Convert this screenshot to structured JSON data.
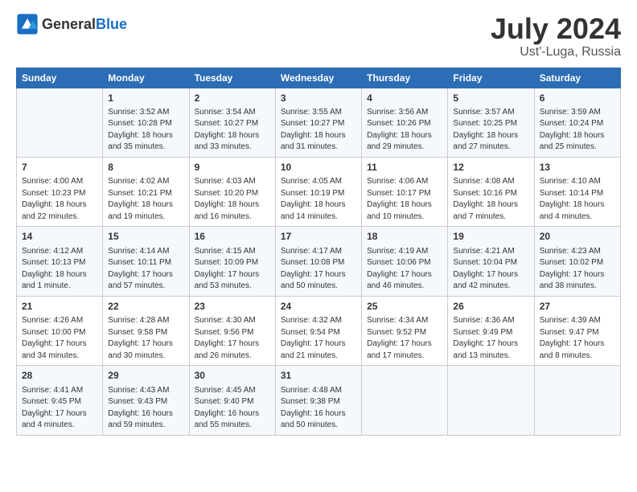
{
  "header": {
    "logo_general": "General",
    "logo_blue": "Blue",
    "title": "July 2024",
    "subtitle": "Ust'-Luga, Russia"
  },
  "columns": [
    "Sunday",
    "Monday",
    "Tuesday",
    "Wednesday",
    "Thursday",
    "Friday",
    "Saturday"
  ],
  "weeks": [
    [
      {
        "day": "",
        "info": ""
      },
      {
        "day": "1",
        "info": "Sunrise: 3:52 AM\nSunset: 10:28 PM\nDaylight: 18 hours\nand 35 minutes."
      },
      {
        "day": "2",
        "info": "Sunrise: 3:54 AM\nSunset: 10:27 PM\nDaylight: 18 hours\nand 33 minutes."
      },
      {
        "day": "3",
        "info": "Sunrise: 3:55 AM\nSunset: 10:27 PM\nDaylight: 18 hours\nand 31 minutes."
      },
      {
        "day": "4",
        "info": "Sunrise: 3:56 AM\nSunset: 10:26 PM\nDaylight: 18 hours\nand 29 minutes."
      },
      {
        "day": "5",
        "info": "Sunrise: 3:57 AM\nSunset: 10:25 PM\nDaylight: 18 hours\nand 27 minutes."
      },
      {
        "day": "6",
        "info": "Sunrise: 3:59 AM\nSunset: 10:24 PM\nDaylight: 18 hours\nand 25 minutes."
      }
    ],
    [
      {
        "day": "7",
        "info": "Sunrise: 4:00 AM\nSunset: 10:23 PM\nDaylight: 18 hours\nand 22 minutes."
      },
      {
        "day": "8",
        "info": "Sunrise: 4:02 AM\nSunset: 10:21 PM\nDaylight: 18 hours\nand 19 minutes."
      },
      {
        "day": "9",
        "info": "Sunrise: 4:03 AM\nSunset: 10:20 PM\nDaylight: 18 hours\nand 16 minutes."
      },
      {
        "day": "10",
        "info": "Sunrise: 4:05 AM\nSunset: 10:19 PM\nDaylight: 18 hours\nand 14 minutes."
      },
      {
        "day": "11",
        "info": "Sunrise: 4:06 AM\nSunset: 10:17 PM\nDaylight: 18 hours\nand 10 minutes."
      },
      {
        "day": "12",
        "info": "Sunrise: 4:08 AM\nSunset: 10:16 PM\nDaylight: 18 hours\nand 7 minutes."
      },
      {
        "day": "13",
        "info": "Sunrise: 4:10 AM\nSunset: 10:14 PM\nDaylight: 18 hours\nand 4 minutes."
      }
    ],
    [
      {
        "day": "14",
        "info": "Sunrise: 4:12 AM\nSunset: 10:13 PM\nDaylight: 18 hours\nand 1 minute."
      },
      {
        "day": "15",
        "info": "Sunrise: 4:14 AM\nSunset: 10:11 PM\nDaylight: 17 hours\nand 57 minutes."
      },
      {
        "day": "16",
        "info": "Sunrise: 4:15 AM\nSunset: 10:09 PM\nDaylight: 17 hours\nand 53 minutes."
      },
      {
        "day": "17",
        "info": "Sunrise: 4:17 AM\nSunset: 10:08 PM\nDaylight: 17 hours\nand 50 minutes."
      },
      {
        "day": "18",
        "info": "Sunrise: 4:19 AM\nSunset: 10:06 PM\nDaylight: 17 hours\nand 46 minutes."
      },
      {
        "day": "19",
        "info": "Sunrise: 4:21 AM\nSunset: 10:04 PM\nDaylight: 17 hours\nand 42 minutes."
      },
      {
        "day": "20",
        "info": "Sunrise: 4:23 AM\nSunset: 10:02 PM\nDaylight: 17 hours\nand 38 minutes."
      }
    ],
    [
      {
        "day": "21",
        "info": "Sunrise: 4:26 AM\nSunset: 10:00 PM\nDaylight: 17 hours\nand 34 minutes."
      },
      {
        "day": "22",
        "info": "Sunrise: 4:28 AM\nSunset: 9:58 PM\nDaylight: 17 hours\nand 30 minutes."
      },
      {
        "day": "23",
        "info": "Sunrise: 4:30 AM\nSunset: 9:56 PM\nDaylight: 17 hours\nand 26 minutes."
      },
      {
        "day": "24",
        "info": "Sunrise: 4:32 AM\nSunset: 9:54 PM\nDaylight: 17 hours\nand 21 minutes."
      },
      {
        "day": "25",
        "info": "Sunrise: 4:34 AM\nSunset: 9:52 PM\nDaylight: 17 hours\nand 17 minutes."
      },
      {
        "day": "26",
        "info": "Sunrise: 4:36 AM\nSunset: 9:49 PM\nDaylight: 17 hours\nand 13 minutes."
      },
      {
        "day": "27",
        "info": "Sunrise: 4:39 AM\nSunset: 9:47 PM\nDaylight: 17 hours\nand 8 minutes."
      }
    ],
    [
      {
        "day": "28",
        "info": "Sunrise: 4:41 AM\nSunset: 9:45 PM\nDaylight: 17 hours\nand 4 minutes."
      },
      {
        "day": "29",
        "info": "Sunrise: 4:43 AM\nSunset: 9:43 PM\nDaylight: 16 hours\nand 59 minutes."
      },
      {
        "day": "30",
        "info": "Sunrise: 4:45 AM\nSunset: 9:40 PM\nDaylight: 16 hours\nand 55 minutes."
      },
      {
        "day": "31",
        "info": "Sunrise: 4:48 AM\nSunset: 9:38 PM\nDaylight: 16 hours\nand 50 minutes."
      },
      {
        "day": "",
        "info": ""
      },
      {
        "day": "",
        "info": ""
      },
      {
        "day": "",
        "info": ""
      }
    ]
  ]
}
